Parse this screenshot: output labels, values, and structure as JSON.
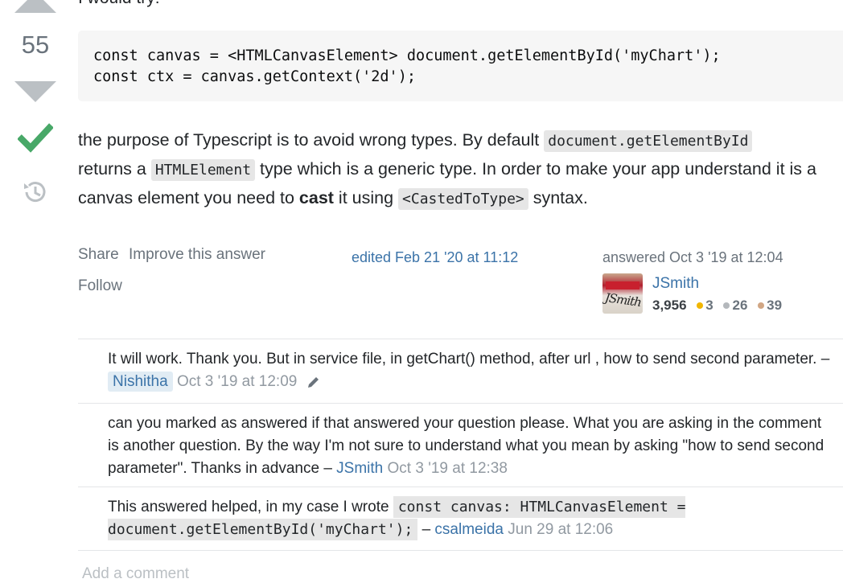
{
  "top_text": "I would try:",
  "vote": {
    "count": "55",
    "upvote_icon": "arrow-up-icon",
    "downvote_icon": "arrow-down-icon",
    "accepted_icon": "checkmark-icon",
    "history_icon": "history-icon",
    "accepted_color": "#48a868"
  },
  "code": {
    "line1": "const canvas = <HTMLCanvasElement> document.getElementById('myChart');",
    "line2": "const ctx = canvas.getContext('2d');"
  },
  "answer": {
    "t1": "the purpose of Typescript is to avoid wrong types. By default ",
    "c1": "document.getElementById",
    "t2": " returns a ",
    "c2": "HTMLElement",
    "t3": " type which is a generic type. In order to make your app understand it is a canvas element you need to ",
    "b1": "cast",
    "t4": " it using ",
    "c3": "<CastedToType>",
    "t5": " syntax."
  },
  "menu": {
    "share": "Share",
    "improve": "Improve this answer",
    "follow": "Follow"
  },
  "edited": "edited Feb 21 '20 at 11:12",
  "author": {
    "answered": "answered Oct 3 '19 at 12:04",
    "name": "JSmith",
    "avatar_text": "JSmith",
    "reputation": "3,956",
    "gold": "3",
    "silver": "26",
    "bronze": "39",
    "gold_color": "#f1b600",
    "silver_color": "#b4b8bc",
    "bronze_color": "#d1a684"
  },
  "comments": [
    {
      "text1": "It will work. Thank you. But in service file, in getChart() method, after url , how to send second parameter. – ",
      "user": "Nishitha",
      "date": "Oct 3 '19 at 12:09"
    },
    {
      "text1": "can you marked as answered if that answered your question please. What you are asking in the comment is another question. By the way I'm not sure to understand what you mean by asking \"how to send second parameter\". Thanks in advance – ",
      "user": "JSmith",
      "date": "Oct 3 '19 at 12:38"
    },
    {
      "text1": "This answered helped, in my case I wrote ",
      "code": "const canvas: HTMLCanvasElement = document.getElementById('myChart');",
      "text2": " – ",
      "user": "csalmeida",
      "date": "Jun 29 at 12:06"
    }
  ],
  "add_comment": "Add a comment"
}
